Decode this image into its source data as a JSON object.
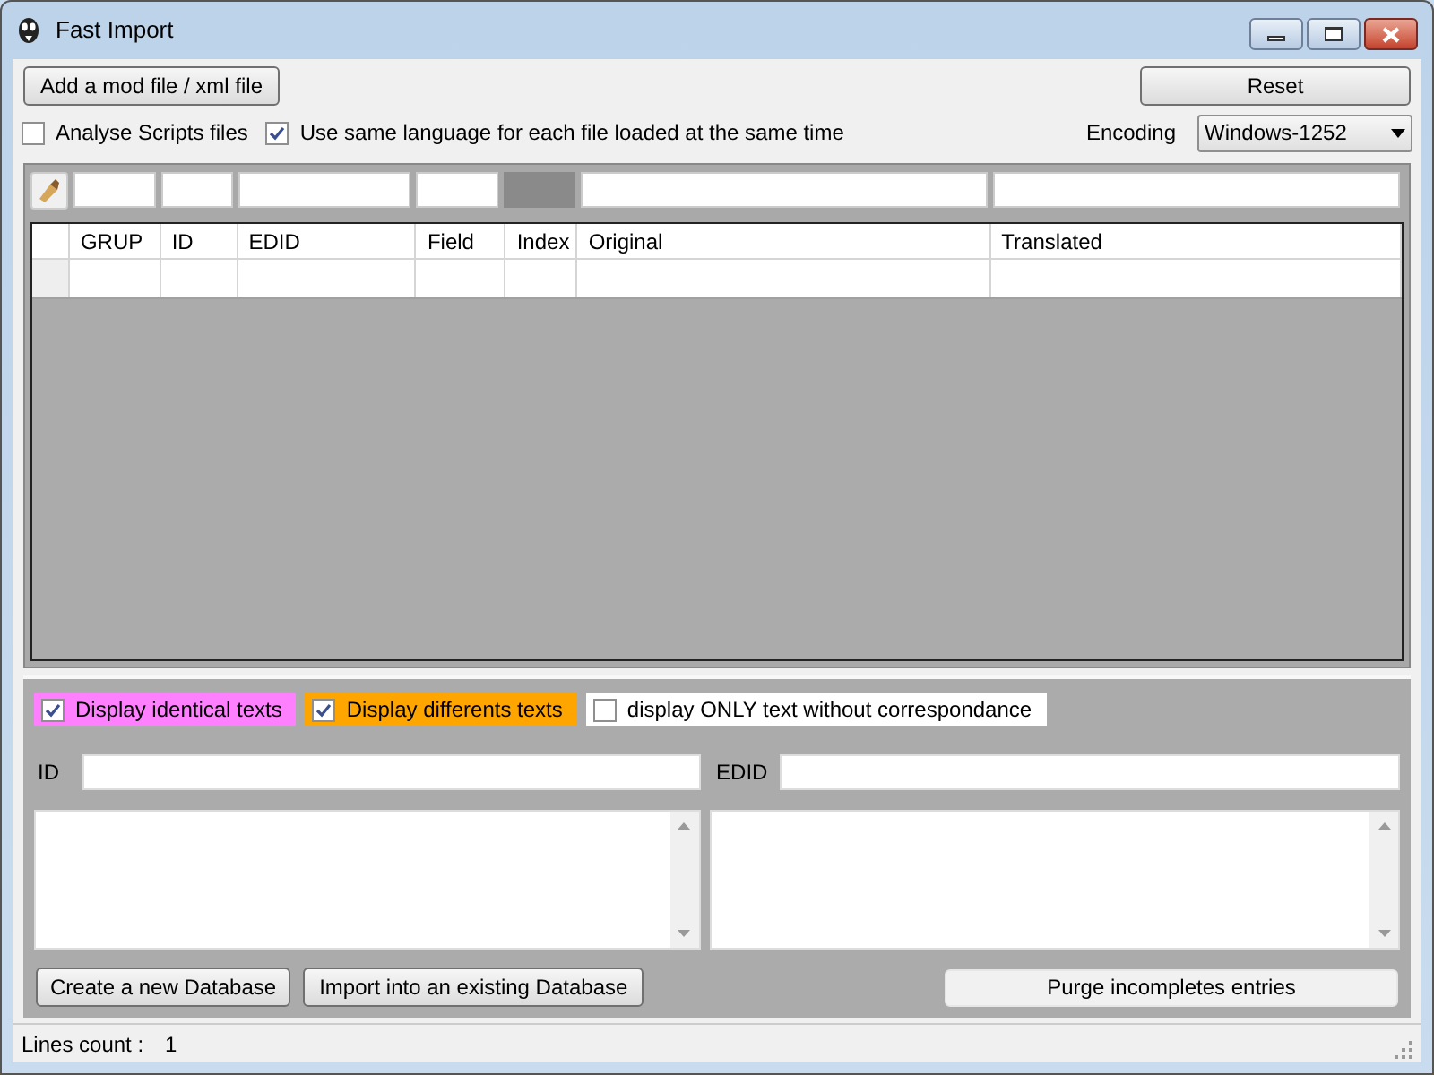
{
  "window": {
    "title": "Fast Import"
  },
  "toolbar": {
    "add_button": "Add a mod file / xml file",
    "reset_button": "Reset"
  },
  "options": [
    {
      "label": "Analyse Scripts files",
      "checked": false
    },
    {
      "label": "Use same language for each file loaded at the same time",
      "checked": true
    }
  ],
  "encoding": {
    "label": "Encoding",
    "value": "Windows-1252"
  },
  "table": {
    "columns": [
      "GRUP",
      "ID",
      "EDID",
      "Field",
      "Index",
      "Original",
      "Translated"
    ]
  },
  "display_filters": [
    {
      "label": "Display identical texts",
      "checked": true,
      "color": "#ff80ff"
    },
    {
      "label": "Display differents texts",
      "checked": true,
      "color": "#ffa500"
    },
    {
      "label": "display ONLY text without correspondance",
      "checked": false,
      "color": "#ffffff"
    }
  ],
  "details": {
    "id_label": "ID",
    "edid_label": "EDID"
  },
  "actions": {
    "create_button": "Create a new Database",
    "import_button": "Import into an existing Database",
    "purge_button": "Purge incompletes entries"
  },
  "status_bar": {
    "label": "Lines count :",
    "value": "1"
  }
}
